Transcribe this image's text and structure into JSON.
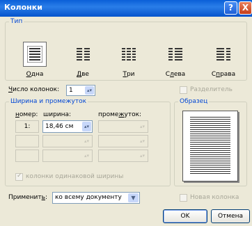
{
  "window": {
    "title": "Колонки",
    "help": "?",
    "close": "X"
  },
  "type_group": {
    "label": "Тип",
    "presets": [
      {
        "label": "Одна",
        "accel": "О",
        "rest": "дна"
      },
      {
        "label": "Две",
        "accel": "Д",
        "rest": "ве"
      },
      {
        "label": "Три",
        "accel": "Т",
        "rest": "ри"
      },
      {
        "label": "Слева",
        "accel": "л",
        "pre": "С",
        "rest": "ева"
      },
      {
        "label": "Справа",
        "accel": "п",
        "pre": "С",
        "rest": "рава"
      }
    ]
  },
  "num_columns": {
    "label_accel": "Ч",
    "label_rest": "исло колонок:",
    "value": "1"
  },
  "separator": {
    "label": "Разделитель"
  },
  "width_group": {
    "label": "Ширина и промежуток",
    "col_header_accel": "н",
    "col_header_rest": "омер:",
    "width_header": "ширина:",
    "spacing_header_pre": "проме",
    "spacing_header_accel": "ж",
    "spacing_header_rest": "уток:",
    "row1_number": "1:",
    "row1_width": "18,46 см"
  },
  "equal_width": {
    "label": "колонки одинаковой ширины"
  },
  "preview_group": {
    "label": "Образец"
  },
  "apply": {
    "label_pre": "Применит",
    "label_accel": "ь",
    "label_rest": ":",
    "value": "ко всему документу"
  },
  "new_column": {
    "label": "Новая колонка"
  },
  "buttons": {
    "ok": "OK",
    "cancel": "Отмена"
  }
}
